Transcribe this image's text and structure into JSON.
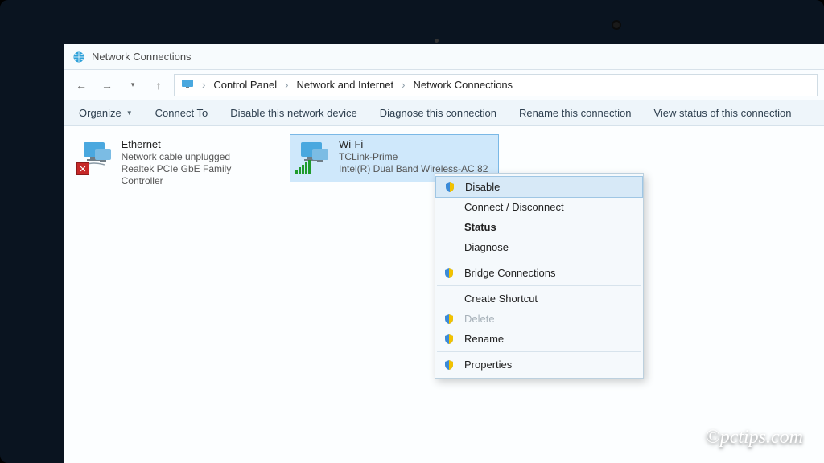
{
  "window": {
    "title": "Network Connections"
  },
  "breadcrumb": {
    "items": [
      "Control Panel",
      "Network and Internet",
      "Network Connections"
    ]
  },
  "toolbar": {
    "organize": "Organize",
    "connect_to": "Connect To",
    "disable_device": "Disable this network device",
    "diagnose": "Diagnose this connection",
    "rename": "Rename this connection",
    "view_status": "View status of this connection"
  },
  "connections": [
    {
      "name": "Ethernet",
      "status": "Network cable unplugged",
      "adapter": "Realtek PCIe GbE Family Controller",
      "selected": false
    },
    {
      "name": "Wi-Fi",
      "status": "TCLink-Prime",
      "adapter": "Intel(R) Dual Band Wireless-AC 82",
      "selected": true
    }
  ],
  "context_menu": {
    "items": [
      {
        "label": "Disable",
        "shield": true,
        "hover": true
      },
      {
        "label": "Connect / Disconnect"
      },
      {
        "label": "Status",
        "bold": true
      },
      {
        "label": "Diagnose"
      },
      {
        "sep": true
      },
      {
        "label": "Bridge Connections",
        "shield": true
      },
      {
        "sep": true
      },
      {
        "label": "Create Shortcut"
      },
      {
        "label": "Delete",
        "shield": true,
        "disabled": true
      },
      {
        "label": "Rename",
        "shield": true
      },
      {
        "sep": true
      },
      {
        "label": "Properties",
        "shield": true
      }
    ]
  },
  "watermark": "©pctips.com"
}
